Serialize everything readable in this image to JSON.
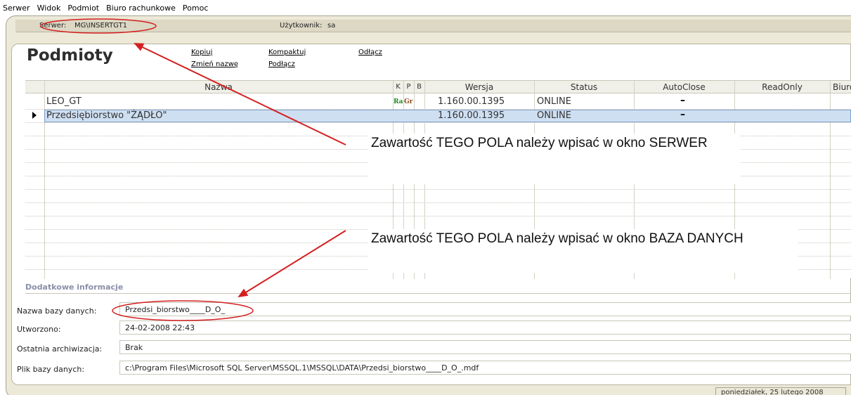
{
  "menu": [
    {
      "label": "Serwer"
    },
    {
      "label": "Widok"
    },
    {
      "label": "Podmiot"
    },
    {
      "label": "Biuro rachunkowe"
    },
    {
      "label": "Pomoc"
    }
  ],
  "serverbar": {
    "server_label": "Serwer:",
    "server_value": "MG\\INSERTGT1",
    "user_label": "Użytkownik:",
    "user_value": "sa"
  },
  "page": {
    "title": "Podmioty"
  },
  "actions": {
    "kopiuj": "Kopiuj",
    "zmien_nazwe": "Zmień nazwę",
    "kompaktuj": "Kompaktuj",
    "podlacz": "Podłącz",
    "odlacz": "Odłącz"
  },
  "grid": {
    "columns": [
      "Nazwa",
      "K",
      "P",
      "B",
      "Wersja",
      "Status",
      "AutoClose",
      "ReadOnly",
      "Biuro"
    ],
    "rows": [
      {
        "name": "LEO_GT",
        "k": "Ra",
        "p": "Gr",
        "b": "",
        "version": "1.160.00.1395",
        "status": "ONLINE",
        "autoclose": "–",
        "readonly": "",
        "selected": false
      },
      {
        "name": "Przedsiębiorstwo \"ŻĄDŁO\"",
        "k": "",
        "p": "",
        "b": "",
        "version": "1.160.00.1395",
        "status": "ONLINE",
        "autoclose": "–",
        "readonly": "",
        "selected": true
      }
    ]
  },
  "annotations": {
    "server_note": "Zawartość TEGO POLA należy wpisać w okno SERWER",
    "db_note": "Zawartość TEGO POLA należy wpisać w okno BAZA DANYCH"
  },
  "details": {
    "title": "Dodatkowe informacje",
    "fields": [
      {
        "label": "Nazwa bazy danych:",
        "value": "Przedsi_biorstwo____D_O_"
      },
      {
        "label": "Utworzono:",
        "value": "24-02-2008 22:43"
      },
      {
        "label": "Ostatnia archiwizacja:",
        "value": "Brak"
      },
      {
        "label": "Plik bazy danych:",
        "value": "c:\\Program Files\\Microsoft SQL Server\\MSSQL.1\\MSSQL\\DATA\\Przedsi_biorstwo____D_O_.mdf"
      }
    ]
  },
  "statusbar": {
    "date": "poniedziałek, 25 lutego 2008"
  },
  "colors": {
    "selection": "#cfdff2",
    "annotation_red": "#d42020",
    "frame": "#ece9d8"
  }
}
